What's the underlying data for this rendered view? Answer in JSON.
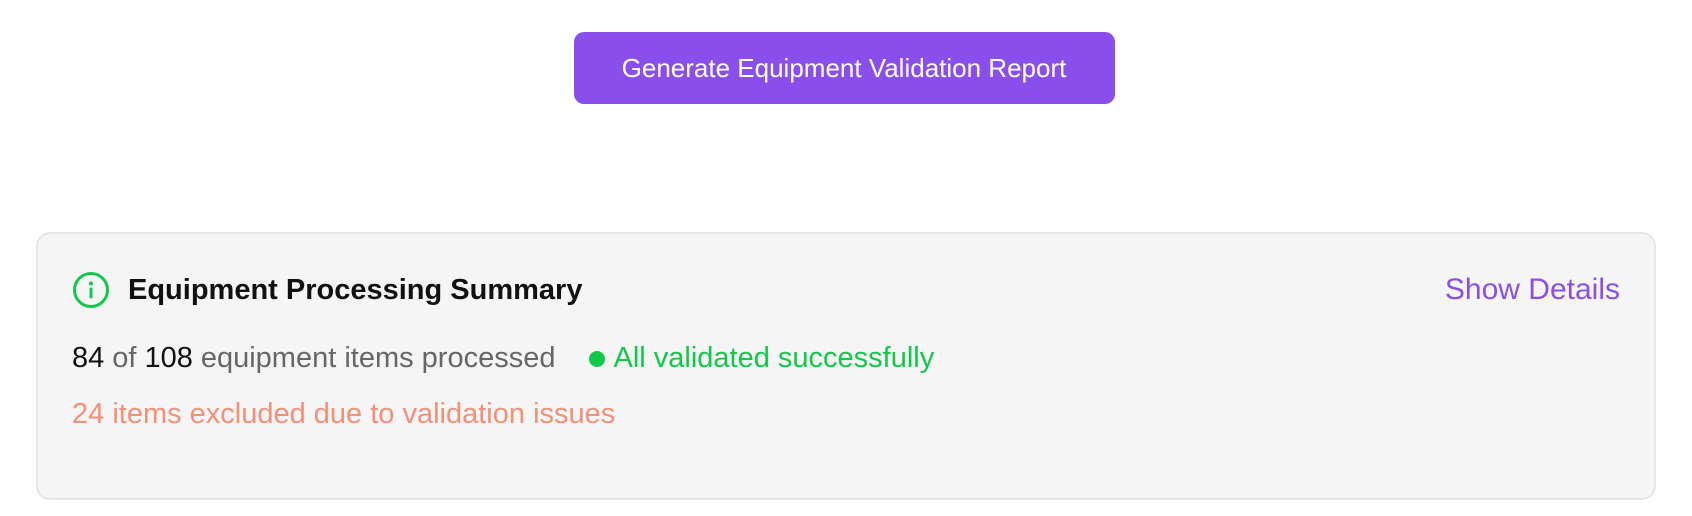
{
  "actions": {
    "generate_label": "Generate Equipment Validation Report"
  },
  "summary": {
    "title": "Equipment Processing Summary",
    "show_details_label": "Show Details",
    "processed_count": "84",
    "of_word": "of",
    "total_count": "108",
    "processed_suffix": "equipment items processed",
    "status_text": "All validated successfully",
    "excluded_text": "24 items excluded due to validation issues",
    "icon": "info-icon"
  },
  "colors": {
    "accent": "#8a4eec",
    "success": "#12c84a",
    "warning": "#f48f78",
    "card_bg": "#f5f5f5"
  }
}
